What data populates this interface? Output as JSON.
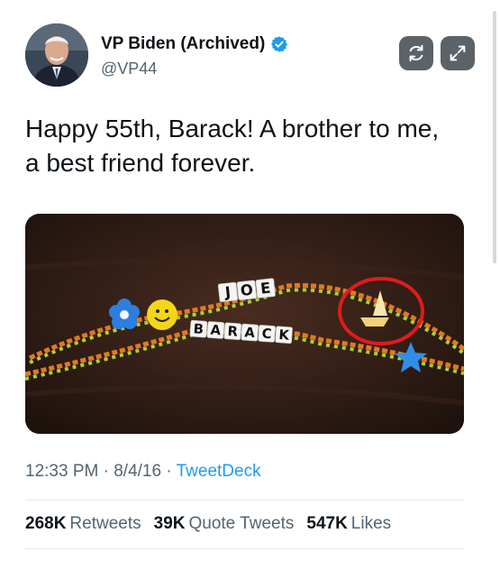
{
  "author": {
    "name": "VP Biden (Archived)",
    "handle": "@VP44",
    "verified": true
  },
  "tweet": {
    "text_line1": "Happy 55th, Barack! A brother to me,",
    "text_line2": "a best friend forever."
  },
  "media": {
    "bead_word_top": "JOE",
    "bead_word_bottom": "BARACK"
  },
  "meta": {
    "time": "12:33 PM",
    "date": "8/4/16",
    "separator": "·",
    "source": "TweetDeck"
  },
  "stats": {
    "retweets_count": "268K",
    "retweets_label": "Retweets",
    "quotes_count": "39K",
    "quotes_label": "Quote Tweets",
    "likes_count": "547K",
    "likes_label": "Likes"
  },
  "icons": {
    "refresh": "refresh-icon",
    "expand": "expand-icon",
    "verified": "verified-badge-icon"
  },
  "colors": {
    "accent": "#1d9bf0",
    "text": "#0f1419",
    "secondary": "#536471"
  }
}
